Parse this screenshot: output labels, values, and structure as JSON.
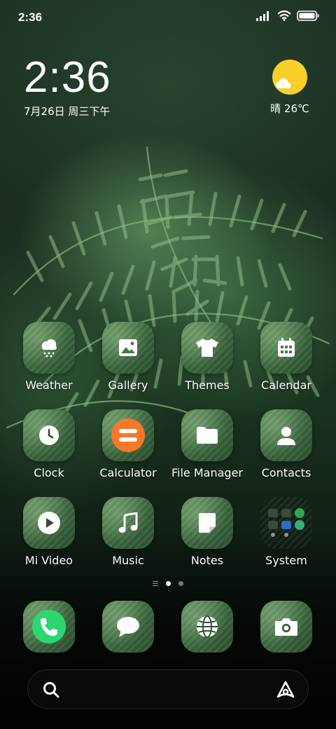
{
  "status_bar": {
    "time": "2:36",
    "icons": [
      "signal-icon",
      "wifi-icon",
      "battery-icon"
    ]
  },
  "clock_widget": {
    "time": "2:36",
    "date": "7月26日 周三下午"
  },
  "weather_widget": {
    "summary": "晴 26℃",
    "icon": "sun-cloud-icon",
    "sun_color": "#f9cf2a"
  },
  "apps": [
    {
      "label": "Weather",
      "icon": "cloud-snow-icon"
    },
    {
      "label": "Gallery",
      "icon": "image-icon"
    },
    {
      "label": "Themes",
      "icon": "tshirt-icon"
    },
    {
      "label": "Calendar",
      "icon": "calendar-icon"
    },
    {
      "label": "Clock",
      "icon": "clock-icon"
    },
    {
      "label": "Calculator",
      "icon": "calculator-icon",
      "color": "#f7772b"
    },
    {
      "label": "File Manager",
      "icon": "folder-icon"
    },
    {
      "label": "Contacts",
      "icon": "person-icon"
    },
    {
      "label": "Mi Video",
      "icon": "play-icon"
    },
    {
      "label": "Music",
      "icon": "music-note-icon"
    },
    {
      "label": "Notes",
      "icon": "note-icon"
    },
    {
      "label": "System",
      "icon": "folder-grid-icon"
    }
  ],
  "page_indicator": {
    "pages": 2,
    "current": 1
  },
  "dock": [
    {
      "icon": "phone-icon",
      "color": "#2ed672"
    },
    {
      "icon": "message-icon"
    },
    {
      "icon": "browser-globe-icon"
    },
    {
      "icon": "camera-icon"
    }
  ],
  "search_bar": {
    "left_icon": "search-icon",
    "right_icon": "assistant-icon"
  }
}
